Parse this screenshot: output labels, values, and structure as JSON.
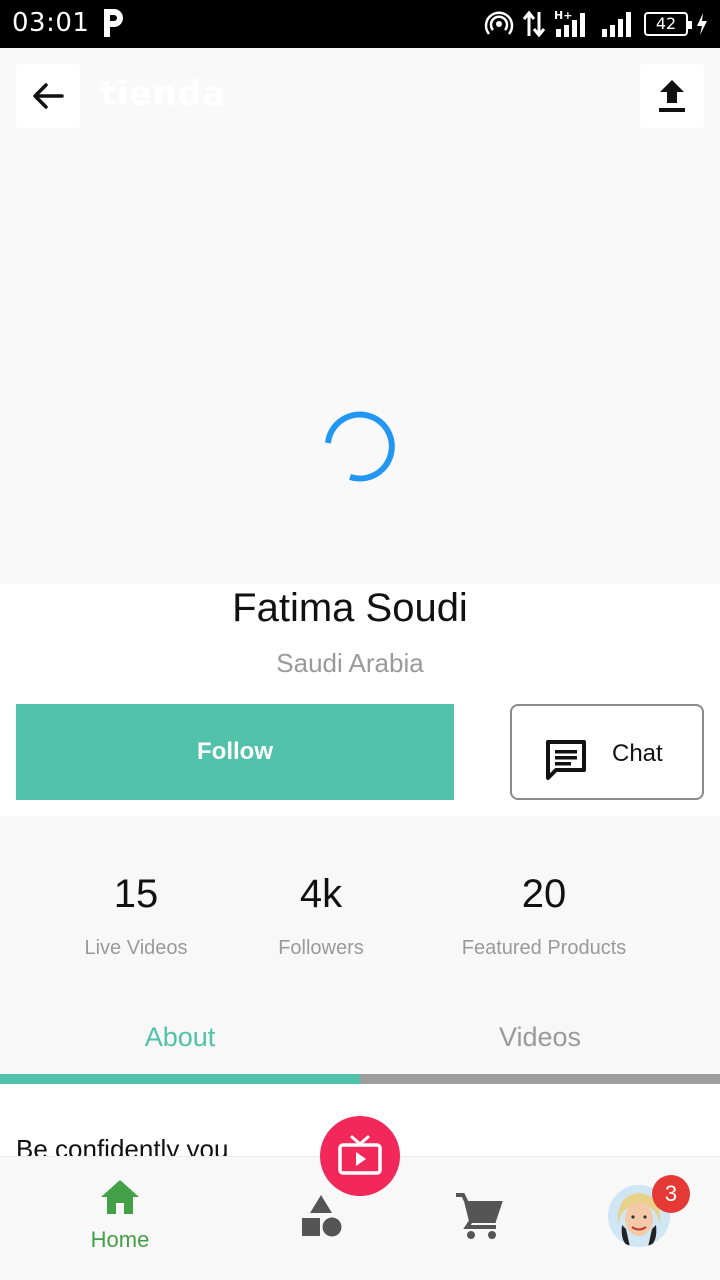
{
  "status_bar": {
    "time": "03:01",
    "battery": "42"
  },
  "header": {
    "brand": "tienda"
  },
  "profile": {
    "name": "Fatima Soudi",
    "country": "Saudi Arabia"
  },
  "actions": {
    "follow_label": "Follow",
    "chat_label": "Chat"
  },
  "stats": [
    {
      "value": "15",
      "label": "Live Videos"
    },
    {
      "value": "4k",
      "label": "Followers"
    },
    {
      "value": "20",
      "label": "Featured Products"
    }
  ],
  "tabs": {
    "about": "About",
    "videos": "Videos"
  },
  "about": {
    "text": "Be confidently you"
  },
  "bottom_nav": {
    "home_label": "Home",
    "badge_count": "3"
  },
  "colors": {
    "accent": "#51c2a9",
    "live": "#f2285a",
    "home_active": "#43a047",
    "spinner": "#2196f3",
    "badge": "#e53935"
  },
  "icons": {
    "back": "arrow-left-icon",
    "upload": "upload-icon",
    "chat": "chat-icon",
    "home": "home-icon",
    "categories": "shapes-icon",
    "cart": "cart-icon",
    "live": "tv-play-icon"
  }
}
